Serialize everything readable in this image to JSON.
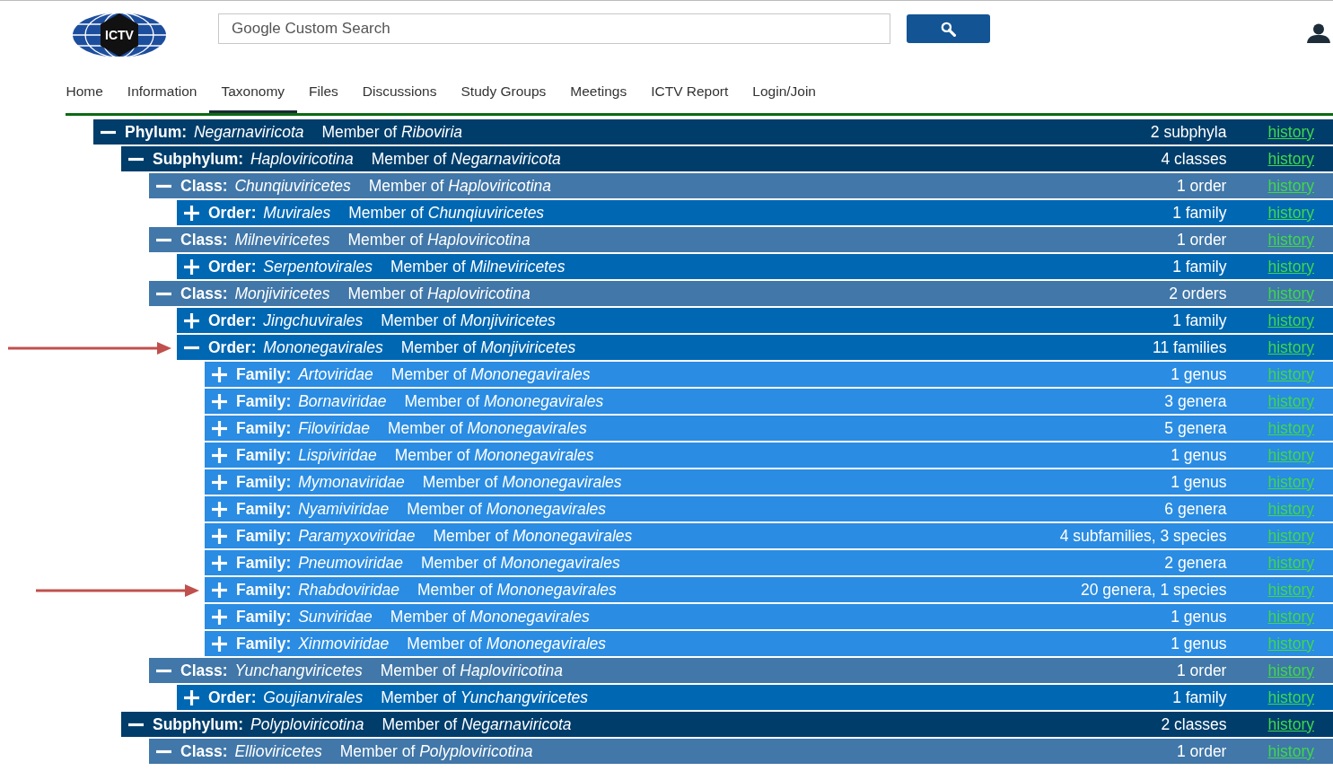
{
  "logo": {
    "text": "ICTV"
  },
  "search": {
    "placeholder": "Google Custom Search"
  },
  "nav": [
    {
      "label": "Home",
      "selected": false
    },
    {
      "label": "Information",
      "selected": false
    },
    {
      "label": "Taxonomy",
      "selected": true
    },
    {
      "label": "Files",
      "selected": false
    },
    {
      "label": "Discussions",
      "selected": false
    },
    {
      "label": "Study Groups",
      "selected": false
    },
    {
      "label": "Meetings",
      "selected": false
    },
    {
      "label": "ICTV Report",
      "selected": false
    },
    {
      "label": "Login/Join",
      "selected": false
    }
  ],
  "tree": [
    {
      "kind": "phylum",
      "title": "**Phylum:** *Negarnaviricota*",
      "member": "Member of *Riboviria*",
      "count": "2 subphyla",
      "link": "history",
      "expanded": true,
      "arrow": false,
      "children": [
        {
          "kind": "subphylum",
          "title": "**Subphylum:** *Haploviricotina*",
          "member": "Member of *Negarnaviricota*",
          "count": "4 classes",
          "link": "history",
          "expanded": true,
          "arrow": false,
          "children": [
            {
              "kind": "class",
              "title": "**Class:** *Chunqiuviricetes*",
              "member": "Member of *Haploviricotina*",
              "count": "1 order",
              "link": "history",
              "expanded": true,
              "arrow": false,
              "children": [
                {
                  "kind": "order",
                  "title": "**Order:** *Muvirales*",
                  "member": "Member of *Chunqiuviricetes*",
                  "count": "1 family",
                  "link": "history",
                  "expanded": false,
                  "arrow": false
                }
              ]
            },
            {
              "kind": "class",
              "title": "**Class:** *Milneviricetes*",
              "member": "Member of *Haploviricotina*",
              "count": "1 order",
              "link": "history",
              "expanded": true,
              "arrow": false,
              "children": [
                {
                  "kind": "order",
                  "title": "**Order:** *Serpentovirales*",
                  "member": "Member of *Milneviricetes*",
                  "count": "1 family",
                  "link": "history",
                  "expanded": false,
                  "arrow": false
                }
              ]
            },
            {
              "kind": "class",
              "title": "**Class:** *Monjiviricetes*",
              "member": "Member of *Haploviricotina*",
              "count": "2 orders",
              "link": "history",
              "expanded": true,
              "arrow": false,
              "children": [
                {
                  "kind": "order",
                  "title": "**Order:** *Jingchuvirales*",
                  "member": "Member of *Monjiviricetes*",
                  "count": "1 family",
                  "link": "history",
                  "expanded": false,
                  "arrow": false
                },
                {
                  "kind": "order",
                  "title": "**Order:** *Mononegavirales*",
                  "member": "Member of *Monjiviricetes*",
                  "count": "11 families",
                  "link": "history",
                  "expanded": true,
                  "arrow": true,
                  "children": [
                    {
                      "kind": "family",
                      "title": "**Family:** *Artoviridae*",
                      "member": "Member of *Mononegavirales*",
                      "count": "1 genus",
                      "link": "history",
                      "expanded": false,
                      "arrow": false
                    },
                    {
                      "kind": "family",
                      "title": "**Family:** *Bornaviridae*",
                      "member": "Member of *Mononegavirales*",
                      "count": "3 genera",
                      "link": "history",
                      "expanded": false,
                      "arrow": false
                    },
                    {
                      "kind": "family",
                      "title": "**Family:** *Filoviridae*",
                      "member": "Member of *Mononegavirales*",
                      "count": "5 genera",
                      "link": "history",
                      "expanded": false,
                      "arrow": false
                    },
                    {
                      "kind": "family",
                      "title": "**Family:** *Lispiviridae*",
                      "member": "Member of *Mononegavirales*",
                      "count": "1 genus",
                      "link": "history",
                      "expanded": false,
                      "arrow": false
                    },
                    {
                      "kind": "family",
                      "title": "**Family:** *Mymonaviridae*",
                      "member": "Member of *Mononegavirales*",
                      "count": "1 genus",
                      "link": "history",
                      "expanded": false,
                      "arrow": false
                    },
                    {
                      "kind": "family",
                      "title": "**Family:** *Nyamiviridae*",
                      "member": "Member of *Mononegavirales*",
                      "count": "6 genera",
                      "link": "history",
                      "expanded": false,
                      "arrow": false
                    },
                    {
                      "kind": "family",
                      "title": "**Family:** *Paramyxoviridae*",
                      "member": "Member of *Mononegavirales*",
                      "count": "4 subfamilies, 3 species",
                      "link": "history",
                      "expanded": false,
                      "arrow": false
                    },
                    {
                      "kind": "family",
                      "title": "**Family:** *Pneumoviridae*",
                      "member": "Member of *Mononegavirales*",
                      "count": "2 genera",
                      "link": "history",
                      "expanded": false,
                      "arrow": false
                    },
                    {
                      "kind": "family",
                      "title": "**Family:** *Rhabdoviridae*",
                      "member": "Member of *Mononegavirales*",
                      "count": "20 genera, 1 species",
                      "link": "history",
                      "expanded": false,
                      "arrow": true
                    },
                    {
                      "kind": "family",
                      "title": "**Family:** *Sunviridae*",
                      "member": "Member of *Mononegavirales*",
                      "count": "1 genus",
                      "link": "history",
                      "expanded": false,
                      "arrow": false
                    },
                    {
                      "kind": "family",
                      "title": "**Family:** *Xinmoviridae*",
                      "member": "Member of *Mononegavirales*",
                      "count": "1 genus",
                      "link": "history",
                      "expanded": false,
                      "arrow": false
                    }
                  ]
                }
              ]
            },
            {
              "kind": "class",
              "title": "**Class:** *Yunchangviricetes*",
              "member": "Member of *Haploviricotina*",
              "count": "1 order",
              "link": "history",
              "expanded": true,
              "arrow": false,
              "children": [
                {
                  "kind": "order",
                  "title": "**Order:** *Goujianvirales*",
                  "member": "Member of *Yunchangviricetes*",
                  "count": "1 family",
                  "link": "history",
                  "expanded": false,
                  "arrow": false
                }
              ]
            }
          ]
        },
        {
          "kind": "subphylum",
          "title": "**Subphylum:** *Polyploviricotina*",
          "member": "Member of *Negarnaviricota*",
          "count": "2 classes",
          "link": "history",
          "expanded": true,
          "arrow": false,
          "children": [
            {
              "kind": "class",
              "title": "**Class:** *Ellioviricetes*",
              "member": "Member of *Polyploviricotina*",
              "count": "1 order",
              "link": "history",
              "expanded": true,
              "arrow": false
            }
          ]
        }
      ]
    }
  ]
}
